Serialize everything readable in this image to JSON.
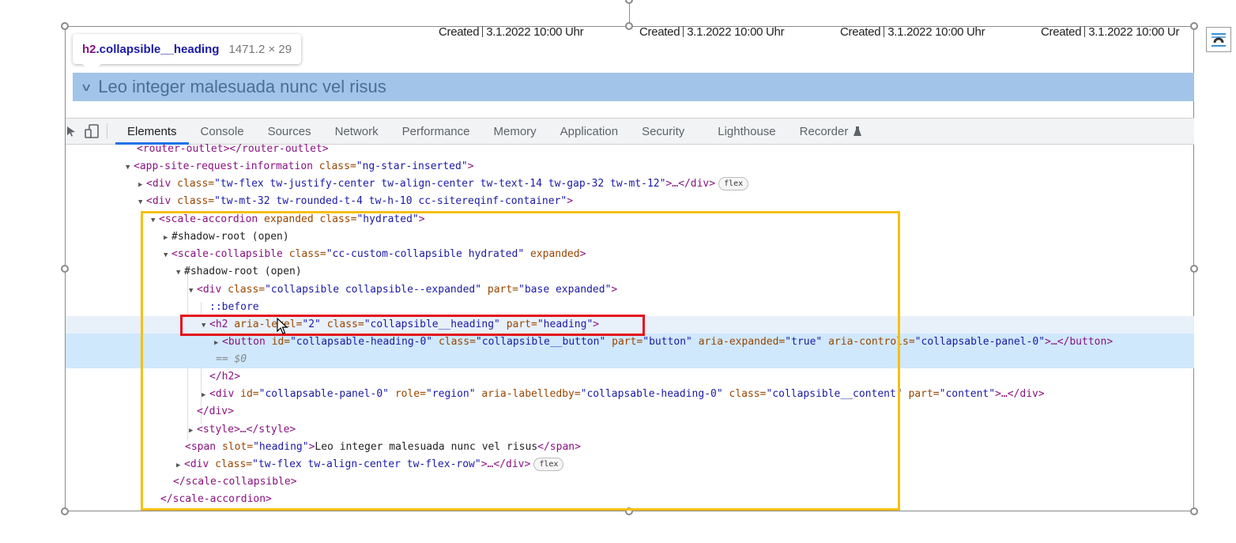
{
  "page": {
    "created_items": [
      {
        "label": "Created",
        "value": "3.1.2022 10:00 Uhr"
      },
      {
        "label": "Created",
        "value": "3.1.2022 10:00 Uhr"
      },
      {
        "label": "Created",
        "value": "3.1.2022 10:00 Uhr"
      },
      {
        "label": "Created",
        "value": "3.1.2022 10:00 Ur"
      }
    ],
    "accordion_heading": "Leo integer malesuada nunc vel risus"
  },
  "inspector_tooltip": {
    "tag": "h2",
    "class_name": ".collapsible__heading",
    "dimensions": "1471.2 × 29"
  },
  "devtools": {
    "tabs": [
      "Elements",
      "Console",
      "Sources",
      "Network",
      "Performance",
      "Memory",
      "Application",
      "Security",
      "Lighthouse",
      "Recorder"
    ],
    "active_tab": "Elements",
    "icons": [
      "inspect-element-icon",
      "device-toolbar-icon",
      "recorder-flask-icon"
    ]
  },
  "dom_tree": {
    "l0": {
      "open": "<router-outlet>",
      "close": "</router-outlet>"
    },
    "l1": {
      "tag": "<app-site-request-information",
      "attr1": " class=",
      "val1": "\"ng-star-inserted\"",
      "end": ">"
    },
    "l2": {
      "tag": "<div",
      "attr1": " class=",
      "val1": "\"tw-flex tw-justify-center tw-align-center tw-text-14 tw-gap-32 tw-mt-12\"",
      "end": ">…</div>",
      "badge": "flex"
    },
    "l3": {
      "tag": "<div",
      "attr1": " class=",
      "val1": "\"tw-mt-32 tw-rounded-t-4 tw-h-10 cc-sitereqinf-container\"",
      "end": ">"
    },
    "l4": {
      "tag": "<scale-accordion",
      "attr1": " expanded class=",
      "val1": "\"hydrated\"",
      "end": ">"
    },
    "l5": {
      "text": "#shadow-root (open)"
    },
    "l6": {
      "tag": "<scale-collapsible",
      "attr1": " class=",
      "val1": "\"cc-custom-collapsible hydrated\"",
      "attr2": " expanded",
      "end": ">"
    },
    "l7": {
      "text": "#shadow-root (open)"
    },
    "l8": {
      "tag": "<div",
      "attr1": " class=",
      "val1": "\"collapsible collapsible--expanded\"",
      "attr2": " part=",
      "val2": "\"base expanded\"",
      "end": ">"
    },
    "l9": {
      "text": "::before"
    },
    "l10": {
      "tag": "<h2",
      "attr1": " aria-level=",
      "val1": "\"2\"",
      "attr2": " class=",
      "val2": "\"collapsible__heading\"",
      "attr3": " part=",
      "val3": "\"heading\"",
      "end": ">"
    },
    "l11": {
      "tag": "<button",
      "attr1": " id=",
      "val1": "\"collapsable-heading-0\"",
      "attr2": " class=",
      "val2": "\"collapsible__button\"",
      "attr3": " part=",
      "val3": "\"button\"",
      "attr4": " aria-expanded=",
      "val4": "\"true\"",
      "attr5": " aria-controls=",
      "val5": "\"collapsable-panel-0\"",
      "end": ">…</button>"
    },
    "l12": {
      "text": "== $0"
    },
    "l13": {
      "text": "</h2>"
    },
    "l14": {
      "tag": "<div",
      "attr1": " id=",
      "val1": "\"collapsable-panel-0\"",
      "attr2": " role=",
      "val2": "\"region\"",
      "attr3": " aria-labelledby=",
      "val3": "\"collapsable-heading-0\"",
      "attr4": " class=",
      "val4": "\"collapsible__content\"",
      "attr5": " part=",
      "val5": "\"content\"",
      "end": ">…</div>"
    },
    "l15": {
      "text": "</div>"
    },
    "l16": {
      "text": "<style>…</style>"
    },
    "l17": {
      "tag": "<span",
      "attr1": " slot=",
      "val1": "\"heading\"",
      "end": ">",
      "content": "Leo integer malesuada nunc vel risus",
      "close": "</span>"
    },
    "l18": {
      "tag": "<div",
      "attr1": " class=",
      "val1": "\"tw-flex tw-align-center tw-flex-row\"",
      "end": ">…</div>",
      "badge": "flex"
    },
    "l19": {
      "text": "</scale-collapsible>"
    },
    "l20": {
      "text": "</scale-accordion>"
    }
  },
  "annotation_colors": {
    "yellow_box": "#f6bf13",
    "red_box": "#e4101b",
    "heading_highlight": "#a1c4e8",
    "selected_row": "#cfe8fc"
  }
}
